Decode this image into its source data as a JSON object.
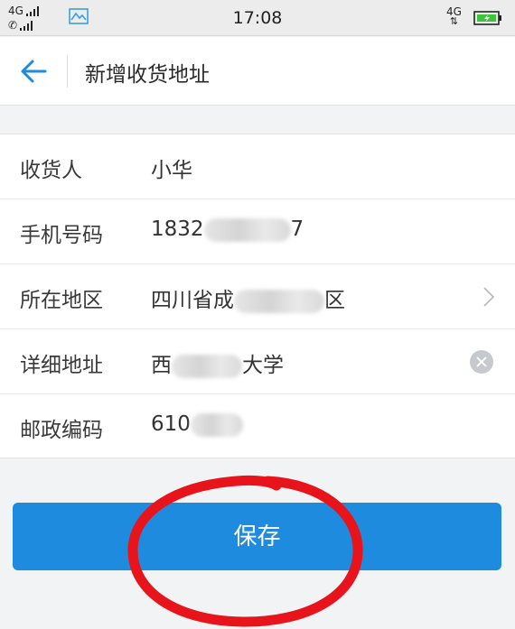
{
  "status_bar": {
    "time": "17:08",
    "sim1_label": "4G",
    "sim2_label": "4G"
  },
  "header": {
    "title": "新增收货地址"
  },
  "form": {
    "rows": [
      {
        "label": "收货人",
        "value_prefix": "小华",
        "value_suffix": ""
      },
      {
        "label": "手机号码",
        "value_prefix": "1832",
        "value_suffix": "7"
      },
      {
        "label": "所在地区",
        "value_prefix": "四川省成",
        "value_suffix": "区"
      },
      {
        "label": "详细地址",
        "value_prefix": "西",
        "value_suffix": "大学"
      },
      {
        "label": "邮政编码",
        "value_prefix": "610",
        "value_suffix": ""
      }
    ]
  },
  "save_button": {
    "label": "保存"
  },
  "colors": {
    "accent": "#1e8bdf",
    "annotation": "#e8141b"
  }
}
